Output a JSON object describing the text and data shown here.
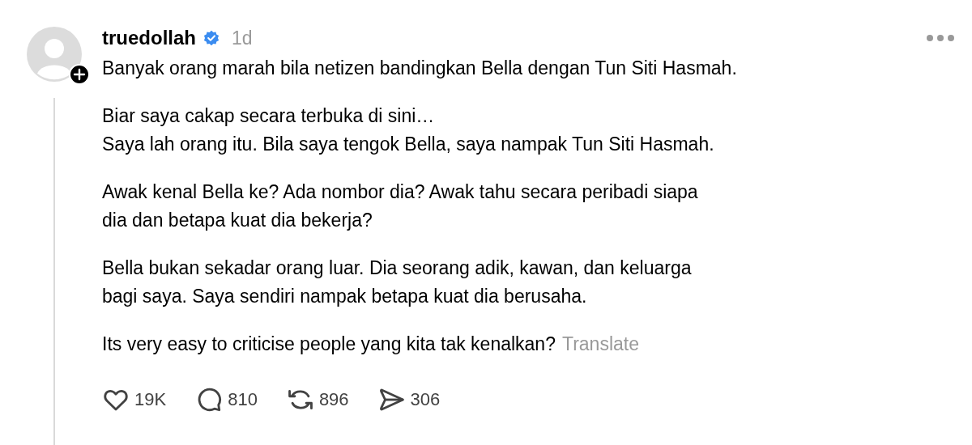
{
  "post": {
    "username": "truedollah",
    "verified": true,
    "time": "1d",
    "follow_badge": true,
    "paragraphs": [
      {
        "lines": [
          "Banyak orang marah bila netizen bandingkan Bella dengan Tun Siti Hasmah."
        ]
      },
      {
        "lines": [
          "Biar saya cakap secara terbuka di sini…",
          "Saya lah orang itu. Bila saya tengok Bella, saya nampak Tun Siti Hasmah."
        ]
      },
      {
        "lines": [
          "Awak kenal Bella ke? Ada nombor dia? Awak tahu secara peribadi siapa",
          "dia dan betapa kuat dia bekerja?"
        ]
      },
      {
        "lines": [
          "Bella bukan sekadar orang luar. Dia seorang adik, kawan, dan keluarga",
          "bagi saya. Saya sendiri nampak betapa kuat dia berusaha."
        ]
      },
      {
        "lines": [
          "Its very easy to criticise people yang kita tak kenalkan?"
        ],
        "link": "Translate"
      }
    ],
    "actions": [
      {
        "kind": "like",
        "count": "19K"
      },
      {
        "kind": "reply",
        "count": "810"
      },
      {
        "kind": "repost",
        "count": "896"
      },
      {
        "kind": "share",
        "count": "306"
      }
    ]
  }
}
